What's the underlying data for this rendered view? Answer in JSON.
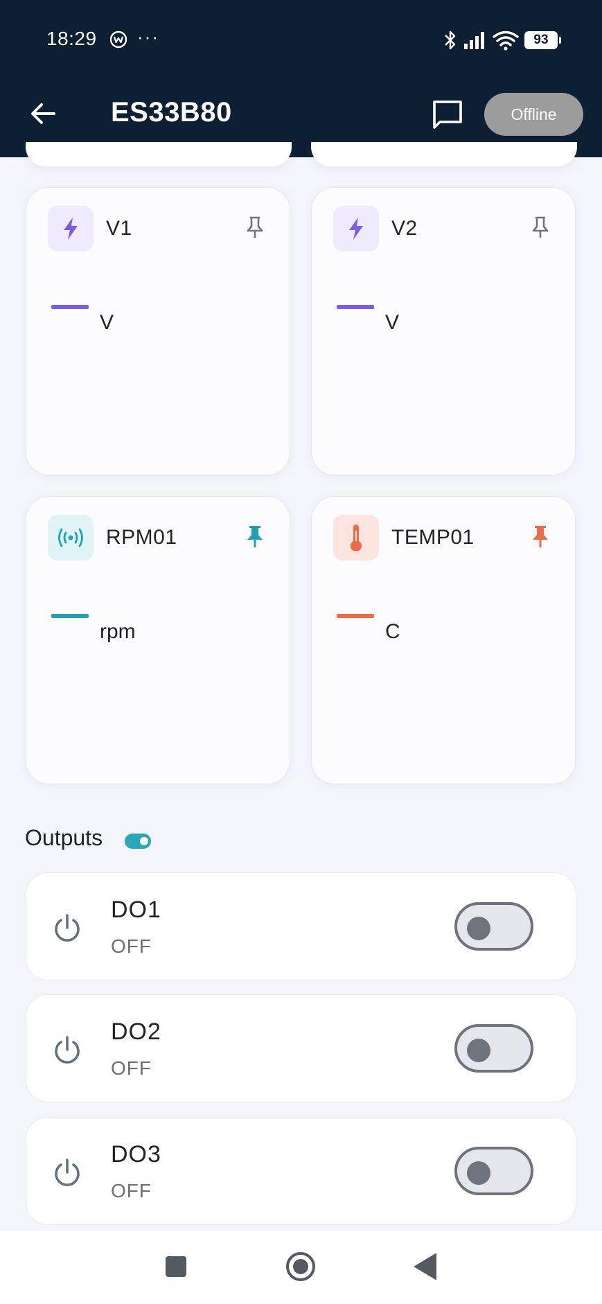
{
  "status_bar": {
    "time": "18:29",
    "more": "···",
    "battery": "93",
    "icons": [
      "app-notification-icon",
      "bluetooth-icon",
      "signal-icon",
      "wifi-icon",
      "battery-icon"
    ]
  },
  "header": {
    "title": "ES33B80",
    "status_label": "Offline",
    "back_icon": "arrow-left-icon",
    "chat_icon": "chat-icon"
  },
  "sensors": [
    {
      "label": "V1",
      "unit": "V",
      "icon": "bolt-icon",
      "pinned": false,
      "color": "#7b5ce6",
      "icon_bg": "#efeafd",
      "pin_color": "#6f737b"
    },
    {
      "label": "V2",
      "unit": "V",
      "icon": "bolt-icon",
      "pinned": false,
      "color": "#7b5ce6",
      "icon_bg": "#efeafd",
      "pin_color": "#6f737b"
    },
    {
      "label": "RPM01",
      "unit": "rpm",
      "icon": "broadcast-icon",
      "pinned": true,
      "color": "#1fa3b2",
      "icon_bg": "#e0f4f6",
      "pin_color": "#1fa3b2"
    },
    {
      "label": "TEMP01",
      "unit": "C",
      "icon": "thermometer-icon",
      "pinned": true,
      "color": "#ef6a45",
      "icon_bg": "#fde5df",
      "pin_color": "#ef6a45"
    }
  ],
  "outputs": {
    "title": "Outputs",
    "items": [
      {
        "name": "DO1",
        "state": "OFF"
      },
      {
        "name": "DO2",
        "state": "OFF"
      },
      {
        "name": "DO3",
        "state": "OFF"
      }
    ]
  },
  "colors": {
    "header_bg": "#0c1f33",
    "page_bg": "#f4f5fb",
    "accent": "#2aa8b9",
    "offline_pill": "#9c9c9c"
  }
}
